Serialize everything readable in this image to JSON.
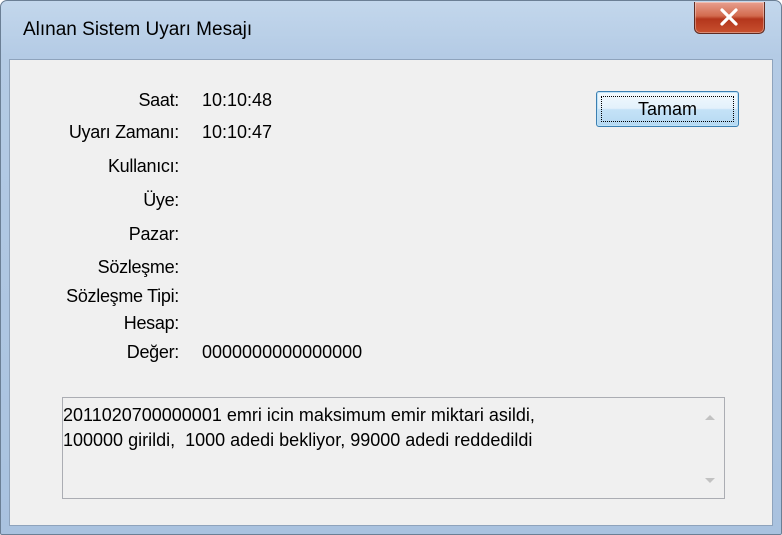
{
  "window": {
    "title": "Alınan Sistem Uyarı Mesajı",
    "close_icon": "close-x-icon"
  },
  "fields": [
    {
      "label": "Saat:",
      "value": "10:10:48"
    },
    {
      "label": "Uyarı Zamanı:",
      "value": "10:10:47"
    },
    {
      "label": "Kullanıcı:",
      "value": ""
    },
    {
      "label": "Üye:",
      "value": ""
    },
    {
      "label": "Pazar:",
      "value": ""
    },
    {
      "label": "Sözleşme:",
      "value": ""
    },
    {
      "label": "Sözleşme Tipi:",
      "value": ""
    },
    {
      "label": "Hesap:",
      "value": ""
    },
    {
      "label": "Değer:",
      "value": "0000000000000000"
    }
  ],
  "ok_button": {
    "label": "Tamam"
  },
  "message": {
    "line1": "2011020700000001 emri icin maksimum emir miktari asildi,",
    "line2": "100000 girildi,  1000 adedi bekliyor, 99000 adedi reddedildi"
  },
  "colors": {
    "frame": "#b4cbe5",
    "client": "#f0f0f0",
    "close_button": "#c8512f"
  }
}
